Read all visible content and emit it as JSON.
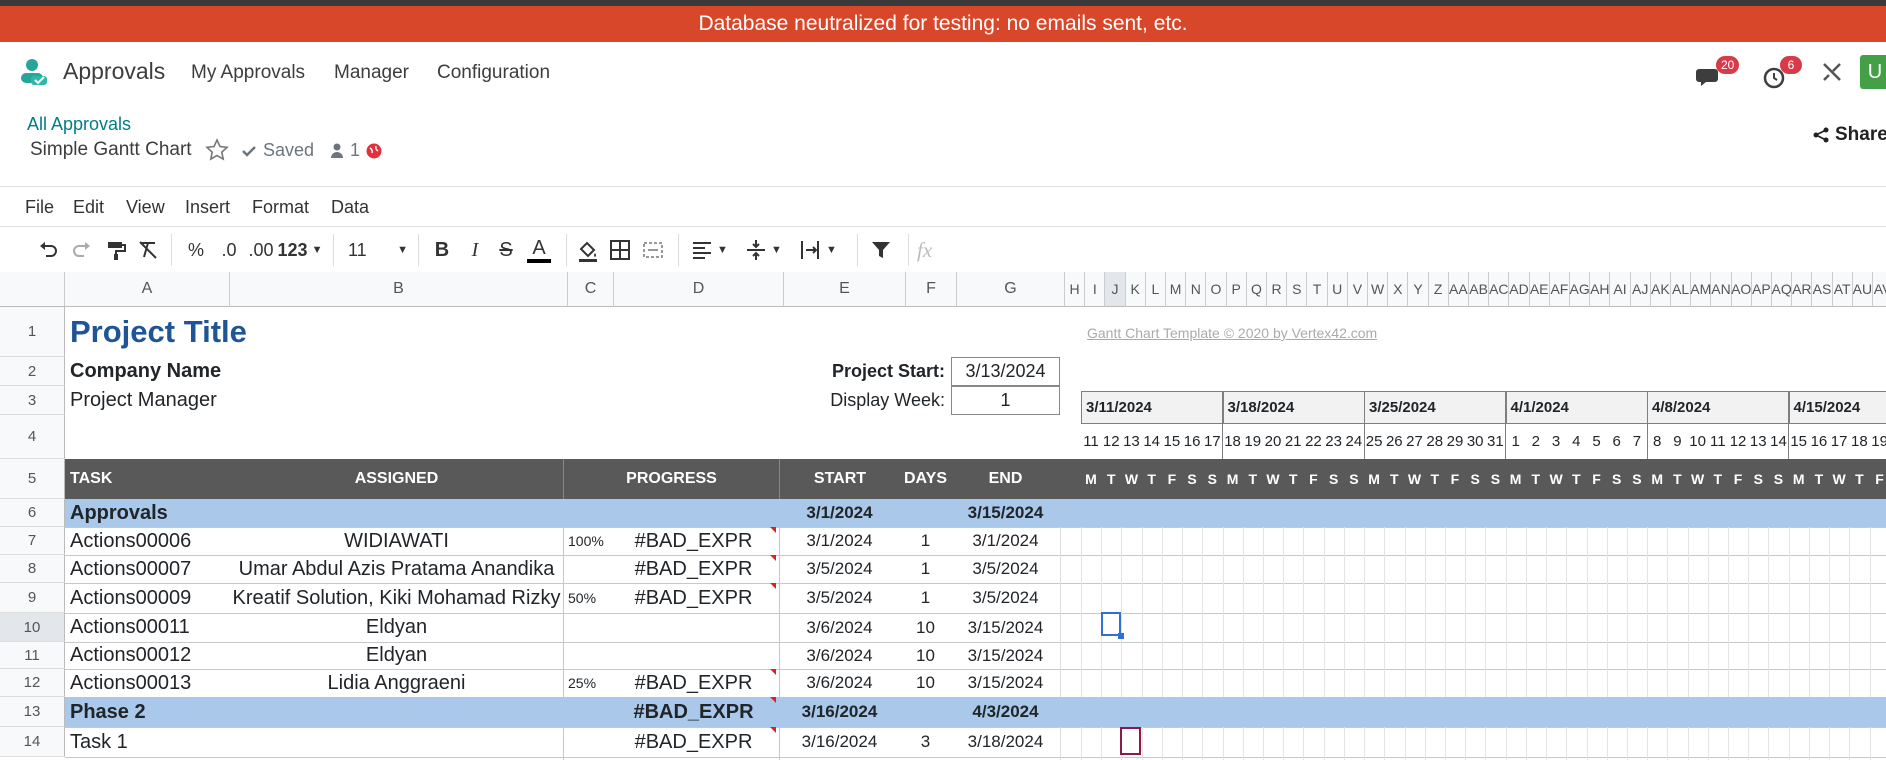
{
  "banner": "Database neutralized for testing: no emails sent, etc.",
  "nav": {
    "app_name": "Approvals",
    "items": [
      "My Approvals",
      "Manager",
      "Configuration"
    ],
    "chat_count": "20",
    "activity_count": "6",
    "avatar_letter": "U"
  },
  "doc": {
    "breadcrumb": "All Approvals",
    "title": "Simple Gantt Chart",
    "saved": "Saved",
    "users": "1",
    "share": "Share"
  },
  "menu": [
    "File",
    "Edit",
    "View",
    "Insert",
    "Format",
    "Data"
  ],
  "toolbar": {
    "percent": "%",
    "dec_less": ".0",
    "dec_more": ".00",
    "num_format": "123",
    "font_size": "11",
    "fx": "fx"
  },
  "columns": [
    "A",
    "B",
    "C",
    "D",
    "E",
    "F",
    "G",
    "H",
    "I",
    "J",
    "K",
    "L",
    "M",
    "N",
    "O",
    "P",
    "Q",
    "R",
    "S",
    "T",
    "U",
    "V",
    "W",
    "X",
    "Y",
    "Z",
    "AA",
    "AB",
    "AC",
    "AD",
    "AE",
    "AF",
    "AG",
    "AH",
    "AI",
    "AJ",
    "AK",
    "AL",
    "AM",
    "AN",
    "AO",
    "AP",
    "AQ",
    "AR",
    "AS",
    "AT",
    "AU",
    "AV"
  ],
  "rows": [
    "1",
    "2",
    "3",
    "4",
    "5",
    "6",
    "7",
    "8",
    "9",
    "10",
    "11",
    "12",
    "13",
    "14"
  ],
  "sheet": {
    "project_title": "Project Title",
    "company": "Company Name",
    "manager": "Project Manager",
    "template_credit": "Gantt Chart Template © 2020 by Vertex42.com",
    "project_start_label": "Project Start:",
    "project_start": "3/13/2024",
    "display_week_label": "Display Week:",
    "display_week": "1",
    "headers": {
      "task": "TASK",
      "assigned": "ASSIGNED",
      "progress": "PROGRESS",
      "start": "START",
      "days": "DAYS",
      "end": "END"
    },
    "weeks": [
      "3/11/2024",
      "3/18/2024",
      "3/25/2024",
      "4/1/2024",
      "4/8/2024",
      "4/15/2024"
    ],
    "day_numbers": [
      "11",
      "12",
      "13",
      "14",
      "15",
      "16",
      "17",
      "18",
      "19",
      "20",
      "21",
      "22",
      "23",
      "24",
      "25",
      "26",
      "27",
      "28",
      "29",
      "30",
      "31",
      "1",
      "2",
      "3",
      "4",
      "5",
      "6",
      "7",
      "8",
      "9",
      "10",
      "11",
      "12",
      "13",
      "14",
      "15",
      "16",
      "17",
      "18",
      "19"
    ],
    "day_letters": [
      "M",
      "T",
      "W",
      "T",
      "F",
      "S",
      "S",
      "M",
      "T",
      "W",
      "T",
      "F",
      "S",
      "S",
      "M",
      "T",
      "W",
      "T",
      "F",
      "S",
      "S",
      "M",
      "T",
      "W",
      "T",
      "F",
      "S",
      "S",
      "M",
      "T",
      "W",
      "T",
      "F",
      "S",
      "S",
      "M",
      "T",
      "W",
      "T",
      "F"
    ],
    "tasks": [
      {
        "task": "Approvals",
        "assigned": "",
        "pct": "",
        "progress": "",
        "start": "3/1/2024",
        "days": "",
        "end": "3/15/2024",
        "phase": true
      },
      {
        "task": "Actions00006",
        "assigned": "WIDIAWATI",
        "pct": "100%",
        "progress": "#BAD_EXPR",
        "start": "3/1/2024",
        "days": "1",
        "end": "3/1/2024",
        "phase": false
      },
      {
        "task": "Actions00007",
        "assigned": "Umar Abdul Azis Pratama Anandika",
        "pct": "",
        "progress": "#BAD_EXPR",
        "start": "3/5/2024",
        "days": "1",
        "end": "3/5/2024",
        "phase": false
      },
      {
        "task": "Actions00009",
        "assigned": "Kreatif Solution, Kiki Mohamad Rizky",
        "pct": "50%",
        "progress": "#BAD_EXPR",
        "start": "3/5/2024",
        "days": "1",
        "end": "3/5/2024",
        "phase": false
      },
      {
        "task": "Actions00011",
        "assigned": "Eldyan",
        "pct": "",
        "progress": "",
        "start": "3/6/2024",
        "days": "10",
        "end": "3/15/2024",
        "phase": false
      },
      {
        "task": "Actions00012",
        "assigned": "Eldyan",
        "pct": "",
        "progress": "",
        "start": "3/6/2024",
        "days": "10",
        "end": "3/15/2024",
        "phase": false
      },
      {
        "task": "Actions00013",
        "assigned": "Lidia Anggraeni",
        "pct": "25%",
        "progress": "#BAD_EXPR",
        "start": "3/6/2024",
        "days": "10",
        "end": "3/15/2024",
        "phase": false
      },
      {
        "task": "Phase 2",
        "assigned": "",
        "pct": "",
        "progress": "#BAD_EXPR",
        "start": "3/16/2024",
        "days": "",
        "end": "4/3/2024",
        "phase": true
      },
      {
        "task": "Task 1",
        "assigned": "",
        "pct": "",
        "progress": "#BAD_EXPR",
        "start": "3/16/2024",
        "days": "3",
        "end": "3/18/2024",
        "phase": false
      }
    ]
  },
  "colors": {
    "banner": "#d9472b",
    "teal": "#017e84",
    "header_bg": "#595959",
    "phase_bg": "#a9c8ea",
    "title_blue": "#1f5597",
    "selection": "#2e6fd8",
    "cursor2": "#8b1a4a"
  }
}
